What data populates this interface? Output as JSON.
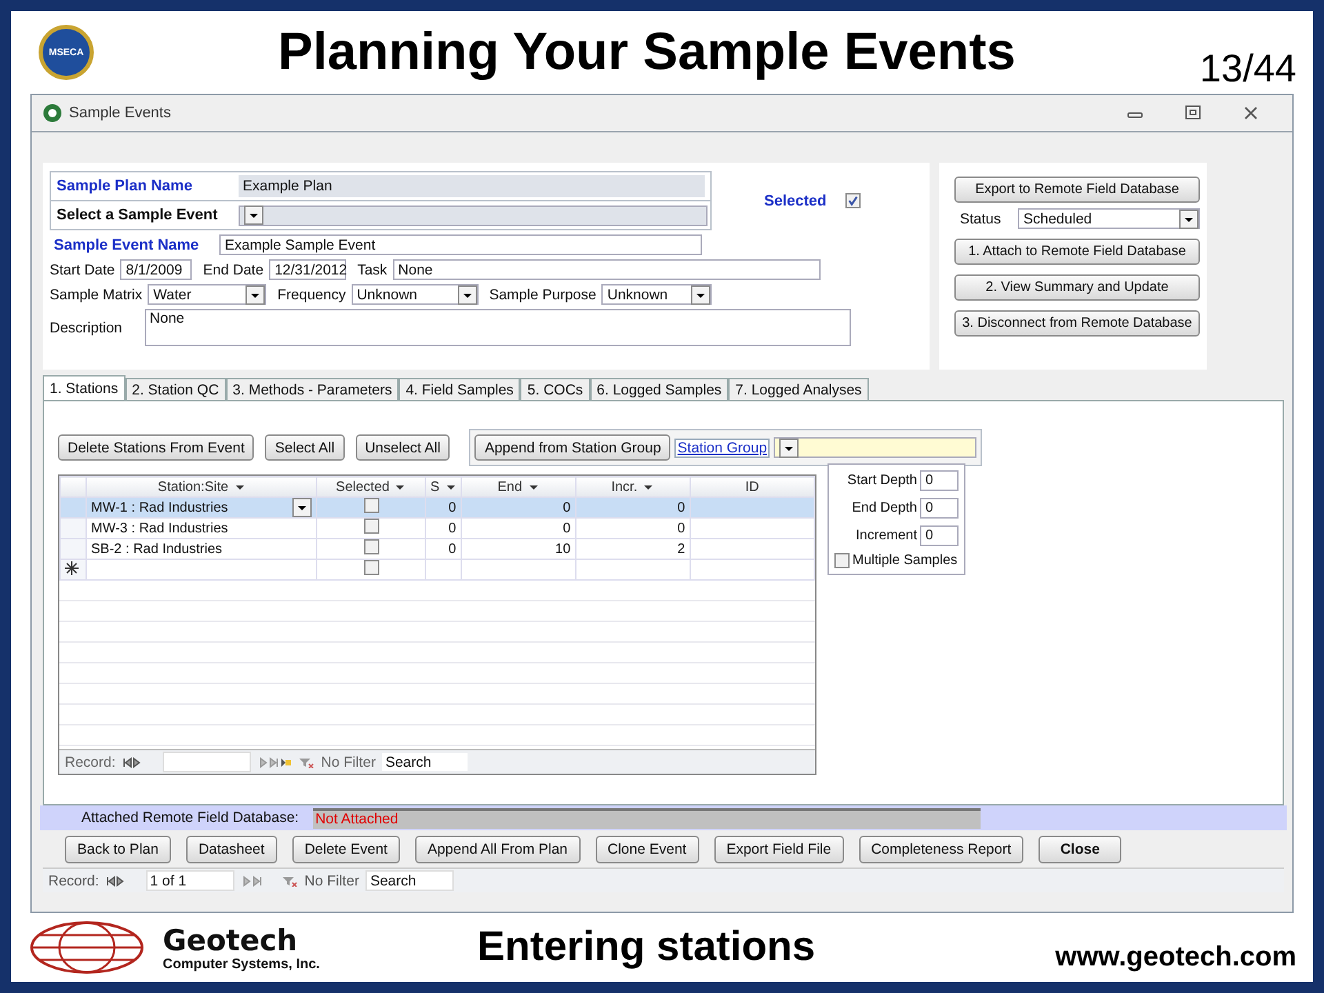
{
  "slide": {
    "logo_text": "MSECA",
    "title": "Planning Your Sample Events",
    "page": "13/44",
    "company": "Geotech",
    "company_sub": "Computer Systems, Inc.",
    "caption": "Entering stations",
    "url": "www.geotech.com"
  },
  "window": {
    "title": "Sample Events"
  },
  "form": {
    "plan_label": "Sample Plan Name",
    "plan_value": "Example Plan",
    "selected_label": "Selected",
    "selected_checked": true,
    "event_select_label": "Select a Sample Event",
    "event_name_label": "Sample Event Name",
    "event_name_value": "Example Sample Event",
    "field_rows": [
      [
        {
          "label": "Start Date",
          "value": "8/1/2009",
          "kind": "text"
        },
        {
          "label": "End Date",
          "value": "12/31/2012",
          "kind": "text"
        },
        {
          "label": "Task",
          "value": "None",
          "kind": "text"
        }
      ],
      [
        {
          "label": "Sample Matrix",
          "value": "Water",
          "kind": "combo"
        },
        {
          "label": "Frequency",
          "value": "Unknown",
          "kind": "combo"
        },
        {
          "label": "Sample Purpose",
          "value": "Unknown",
          "kind": "combo"
        }
      ],
      [
        {
          "label": "Description",
          "value": "None",
          "kind": "memo"
        }
      ]
    ]
  },
  "remote": {
    "export_button": "Export to  Remote Field Database",
    "status_label": "Status",
    "status_value": "Scheduled",
    "buttons": [
      "1. Attach to  Remote Field Database",
      "2. View Summary and Update",
      "3. Disconnect from Remote Database"
    ]
  },
  "tabs": [
    {
      "label": "1. Stations",
      "selected": true
    },
    {
      "label": "2. Station QC",
      "selected": false
    },
    {
      "label": "3. Methods - Parameters",
      "selected": false
    },
    {
      "label": "4. Field Samples",
      "selected": false
    },
    {
      "label": "5. COCs",
      "selected": false
    },
    {
      "label": "6. Logged Samples",
      "selected": false
    },
    {
      "label": "7. Logged Analyses",
      "selected": false
    }
  ],
  "station_buttons": [
    "Delete Stations From Event",
    "Select All",
    "Unselect All"
  ],
  "append": {
    "button": "Append from Station Group",
    "link": "Station Group"
  },
  "grid": {
    "columns": [
      {
        "label": "Station:Site",
        "filter": true
      },
      {
        "label": "Selected",
        "filter": true
      },
      {
        "label": "S",
        "filter": true
      },
      {
        "label": "End",
        "filter": true
      },
      {
        "label": "Incr.",
        "filter": true
      },
      {
        "label": "ID",
        "filter": false
      }
    ],
    "rows": [
      {
        "station": "MW-1 : Rad Industries",
        "checked": false,
        "s": "0",
        "end": "0",
        "incr": "0",
        "selected": true
      },
      {
        "station": "MW-3 : Rad Industries",
        "checked": false,
        "s": "0",
        "end": "0",
        "incr": "0",
        "selected": false
      },
      {
        "station": "SB-2 : Rad Industries",
        "checked": false,
        "s": "0",
        "end": "10",
        "incr": "2",
        "selected": false
      }
    ],
    "new_row_checked": false,
    "nav": {
      "label": "Record:",
      "filter": "No Filter",
      "search": "Search"
    }
  },
  "depth": {
    "fields": [
      {
        "label": "Start Depth",
        "value": "0"
      },
      {
        "label": "End Depth",
        "value": "0"
      },
      {
        "label": "Increment",
        "value": "0"
      }
    ],
    "multiple_label": "Multiple Samples",
    "multiple_checked": false
  },
  "attached": {
    "label": "Attached Remote Field Database:",
    "value": "Not Attached"
  },
  "bottom_buttons": [
    {
      "label": "Back to Plan",
      "kind": "normal"
    },
    {
      "label": "Datasheet",
      "kind": "normal"
    },
    {
      "label": "Delete Event",
      "kind": "normal"
    },
    {
      "label": "Append All From Plan",
      "kind": "normal"
    },
    {
      "label": "Clone Event",
      "kind": "normal"
    },
    {
      "label": "Export Field File",
      "kind": "normal"
    },
    {
      "label": "Completeness Report",
      "kind": "normal"
    },
    {
      "label": "Close",
      "kind": "default"
    }
  ],
  "record_nav": {
    "label": "Record:",
    "position": "1 of 1",
    "filter": "No Filter",
    "search": "Search"
  }
}
